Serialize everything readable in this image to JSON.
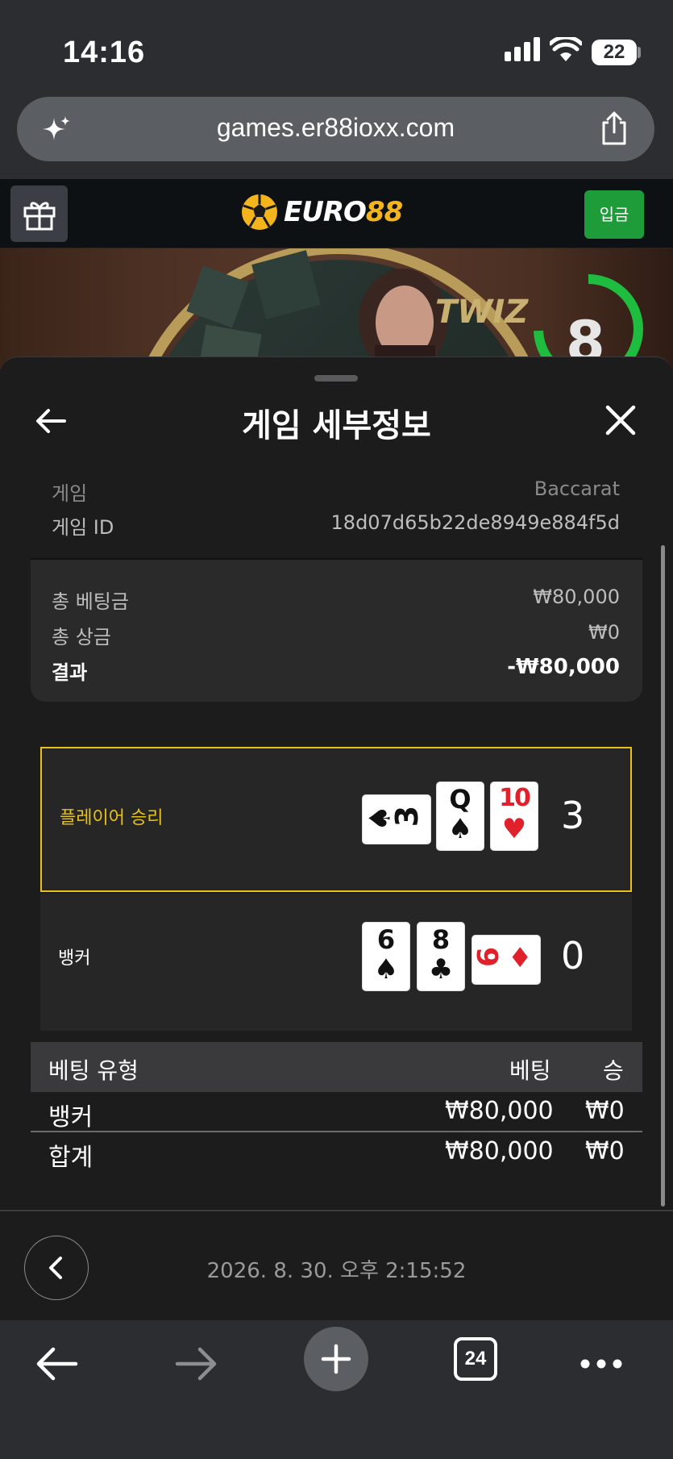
{
  "status_bar": {
    "time": "14:16",
    "battery": "22"
  },
  "browser": {
    "url": "games.er88ioxx.com",
    "tab_count": "24"
  },
  "site_header": {
    "logo_part1": "EURO",
    "logo_part2": "88",
    "deposit_label": "입금"
  },
  "video": {
    "overlay_text": "TWIZ",
    "countdown": "8"
  },
  "sheet": {
    "title": "게임 세부정보",
    "game_label": "게임",
    "game_value": "Baccarat",
    "game_id_label": "게임 ID",
    "game_id_value": "18d07d65b22de8949e884f5d",
    "total_bet_label": "총 베팅금",
    "total_bet_value": "₩80,000",
    "total_prize_label": "총 상금",
    "total_prize_value": "₩0",
    "result_label": "결과",
    "result_value": "-₩80,000"
  },
  "hands": {
    "player": {
      "label": "플레이어 승리",
      "score": "3",
      "cards": [
        {
          "rank": "3",
          "suit": "♠",
          "color": "black",
          "orientation": "sideways"
        },
        {
          "rank": "Q",
          "suit": "♠",
          "color": "black",
          "orientation": "upright"
        },
        {
          "rank": "10",
          "suit": "♥",
          "color": "red",
          "orientation": "upright"
        }
      ]
    },
    "banker": {
      "label": "뱅커",
      "score": "0",
      "cards": [
        {
          "rank": "6",
          "suit": "♠",
          "color": "black",
          "orientation": "upright"
        },
        {
          "rank": "8",
          "suit": "♣",
          "color": "black",
          "orientation": "upright"
        },
        {
          "rank": "6",
          "suit": "♦",
          "color": "red",
          "orientation": "sideways"
        }
      ]
    }
  },
  "bet_table": {
    "headers": {
      "type": "베팅 유형",
      "bet": "베팅",
      "win": "승"
    },
    "rows": [
      {
        "type": "뱅커",
        "bet": "₩80,000",
        "win": "₩0"
      }
    ],
    "total": {
      "type": "합계",
      "bet": "₩80,000",
      "win": "₩0"
    }
  },
  "footer": {
    "timestamp": "2026. 8. 30. 오후 2:15:52"
  },
  "colors": {
    "accent_yellow": "#e8c21a",
    "deposit_green": "#1e9c3a",
    "logo_gold": "#f3b51b",
    "card_red": "#e0202a"
  },
  "icons": [
    "sparkle-icon",
    "share-icon",
    "gift-icon",
    "soccer-ball-icon",
    "back-arrow-icon",
    "close-icon",
    "chevron-left-icon",
    "nav-back-icon",
    "nav-forward-icon",
    "plus-icon",
    "more-icon"
  ]
}
